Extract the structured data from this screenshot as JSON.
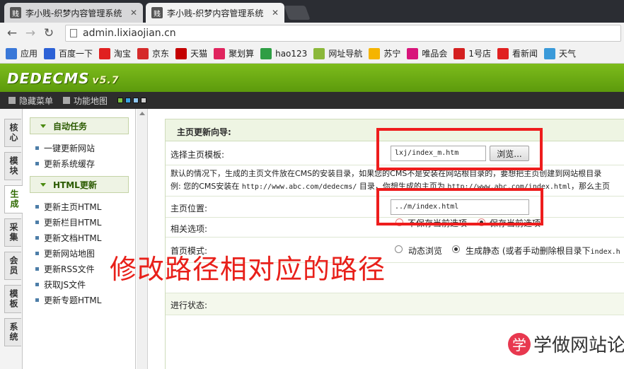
{
  "browser": {
    "tabs": [
      {
        "title": "李小贱-织梦内容管理系统",
        "favicon": "贱",
        "active": false
      },
      {
        "title": "李小贱-织梦内容管理系统",
        "favicon": "贱",
        "active": true
      }
    ],
    "url": "admin.lixiaojian.cn",
    "bookmarks": [
      {
        "label": "应用",
        "icon": "apps-icon",
        "color": "#3a78d8"
      },
      {
        "label": "百度一下",
        "icon": "baidu-icon",
        "color": "#2d62d6"
      },
      {
        "label": "淘宝",
        "icon": "taobao-icon",
        "color": "#e02020"
      },
      {
        "label": "京东",
        "icon": "jd-icon",
        "color": "#d52b2b"
      },
      {
        "label": "天猫",
        "icon": "tmall-icon",
        "color": "#c40000"
      },
      {
        "label": "聚划算",
        "icon": "juhuasuan-icon",
        "color": "#e0245e"
      },
      {
        "label": "hao123",
        "icon": "hao123-icon",
        "color": "#2f9e44"
      },
      {
        "label": "网址导航",
        "icon": "nav-7654-icon",
        "color": "#8bb83a"
      },
      {
        "label": "苏宁",
        "icon": "suning-icon",
        "color": "#f5b400"
      },
      {
        "label": "唯品会",
        "icon": "vip-icon",
        "color": "#d8157b"
      },
      {
        "label": "1号店",
        "icon": "yhd-icon",
        "color": "#d42020"
      },
      {
        "label": "看新闻",
        "icon": "news-icon",
        "color": "#e02020"
      },
      {
        "label": "天气",
        "icon": "weather-icon",
        "color": "#3a9ad9"
      }
    ]
  },
  "cms": {
    "logo": "DEDECMS",
    "version": "v5.7",
    "toolbar": {
      "hide_menu": "隐藏菜单",
      "function_map": "功能地图"
    },
    "skin_colors": [
      "#7cc242",
      "#39a3e3",
      "#8fc7f0",
      "#cfcfcf"
    ],
    "side_tabs": [
      "核心",
      "模块",
      "生成",
      "采集",
      "会员",
      "模板",
      "系统"
    ],
    "active_side_tab": "生成",
    "menu": {
      "groups": [
        {
          "title": "自动任务",
          "items": [
            "一键更新网站",
            "更新系统缓存"
          ]
        },
        {
          "title": "HTML更新",
          "items": [
            "更新主页HTML",
            "更新栏目HTML",
            "更新文档HTML",
            "更新网站地图",
            "更新RSS文件",
            "获取JS文件",
            "更新专题HTML"
          ]
        }
      ]
    },
    "form": {
      "heading": "主页更新向导:",
      "template_label": "选择主页模板:",
      "template_value": "lxj/index_m.htm",
      "browse_button": "浏览...",
      "desc_line1": "默认的情况下，生成的主页文件放在CMS的安装目录，如果您的CMS不是安装在网站根目录的，要想把主页创建到网站根目录",
      "desc_line2_a": "例: 您的CMS安装在 ",
      "desc_line2_b": "http://www.abc.com/dedecms/",
      "desc_line2_c": " 目录，你想生成的主页为 ",
      "desc_line2_d": "http://www.abc.com/index.html",
      "desc_line2_e": "，那么主页",
      "position_label": "主页位置:",
      "position_value": "../m/index.html",
      "related_label": "相关选项:",
      "related_opt1": "不保存当前选项",
      "related_opt2": "保存当前选项",
      "mode_label": "首页模式:",
      "mode_opt1": "动态浏览",
      "mode_opt2": "生成静态",
      "mode_opt2_note": "(或者手动删除根目录下",
      "mode_opt2_file": "index.h",
      "status_label": "进行状态:"
    }
  },
  "annotation": "修改路径相对应的路径",
  "watermark": {
    "badge": "学",
    "text": "学做网站论坛"
  }
}
